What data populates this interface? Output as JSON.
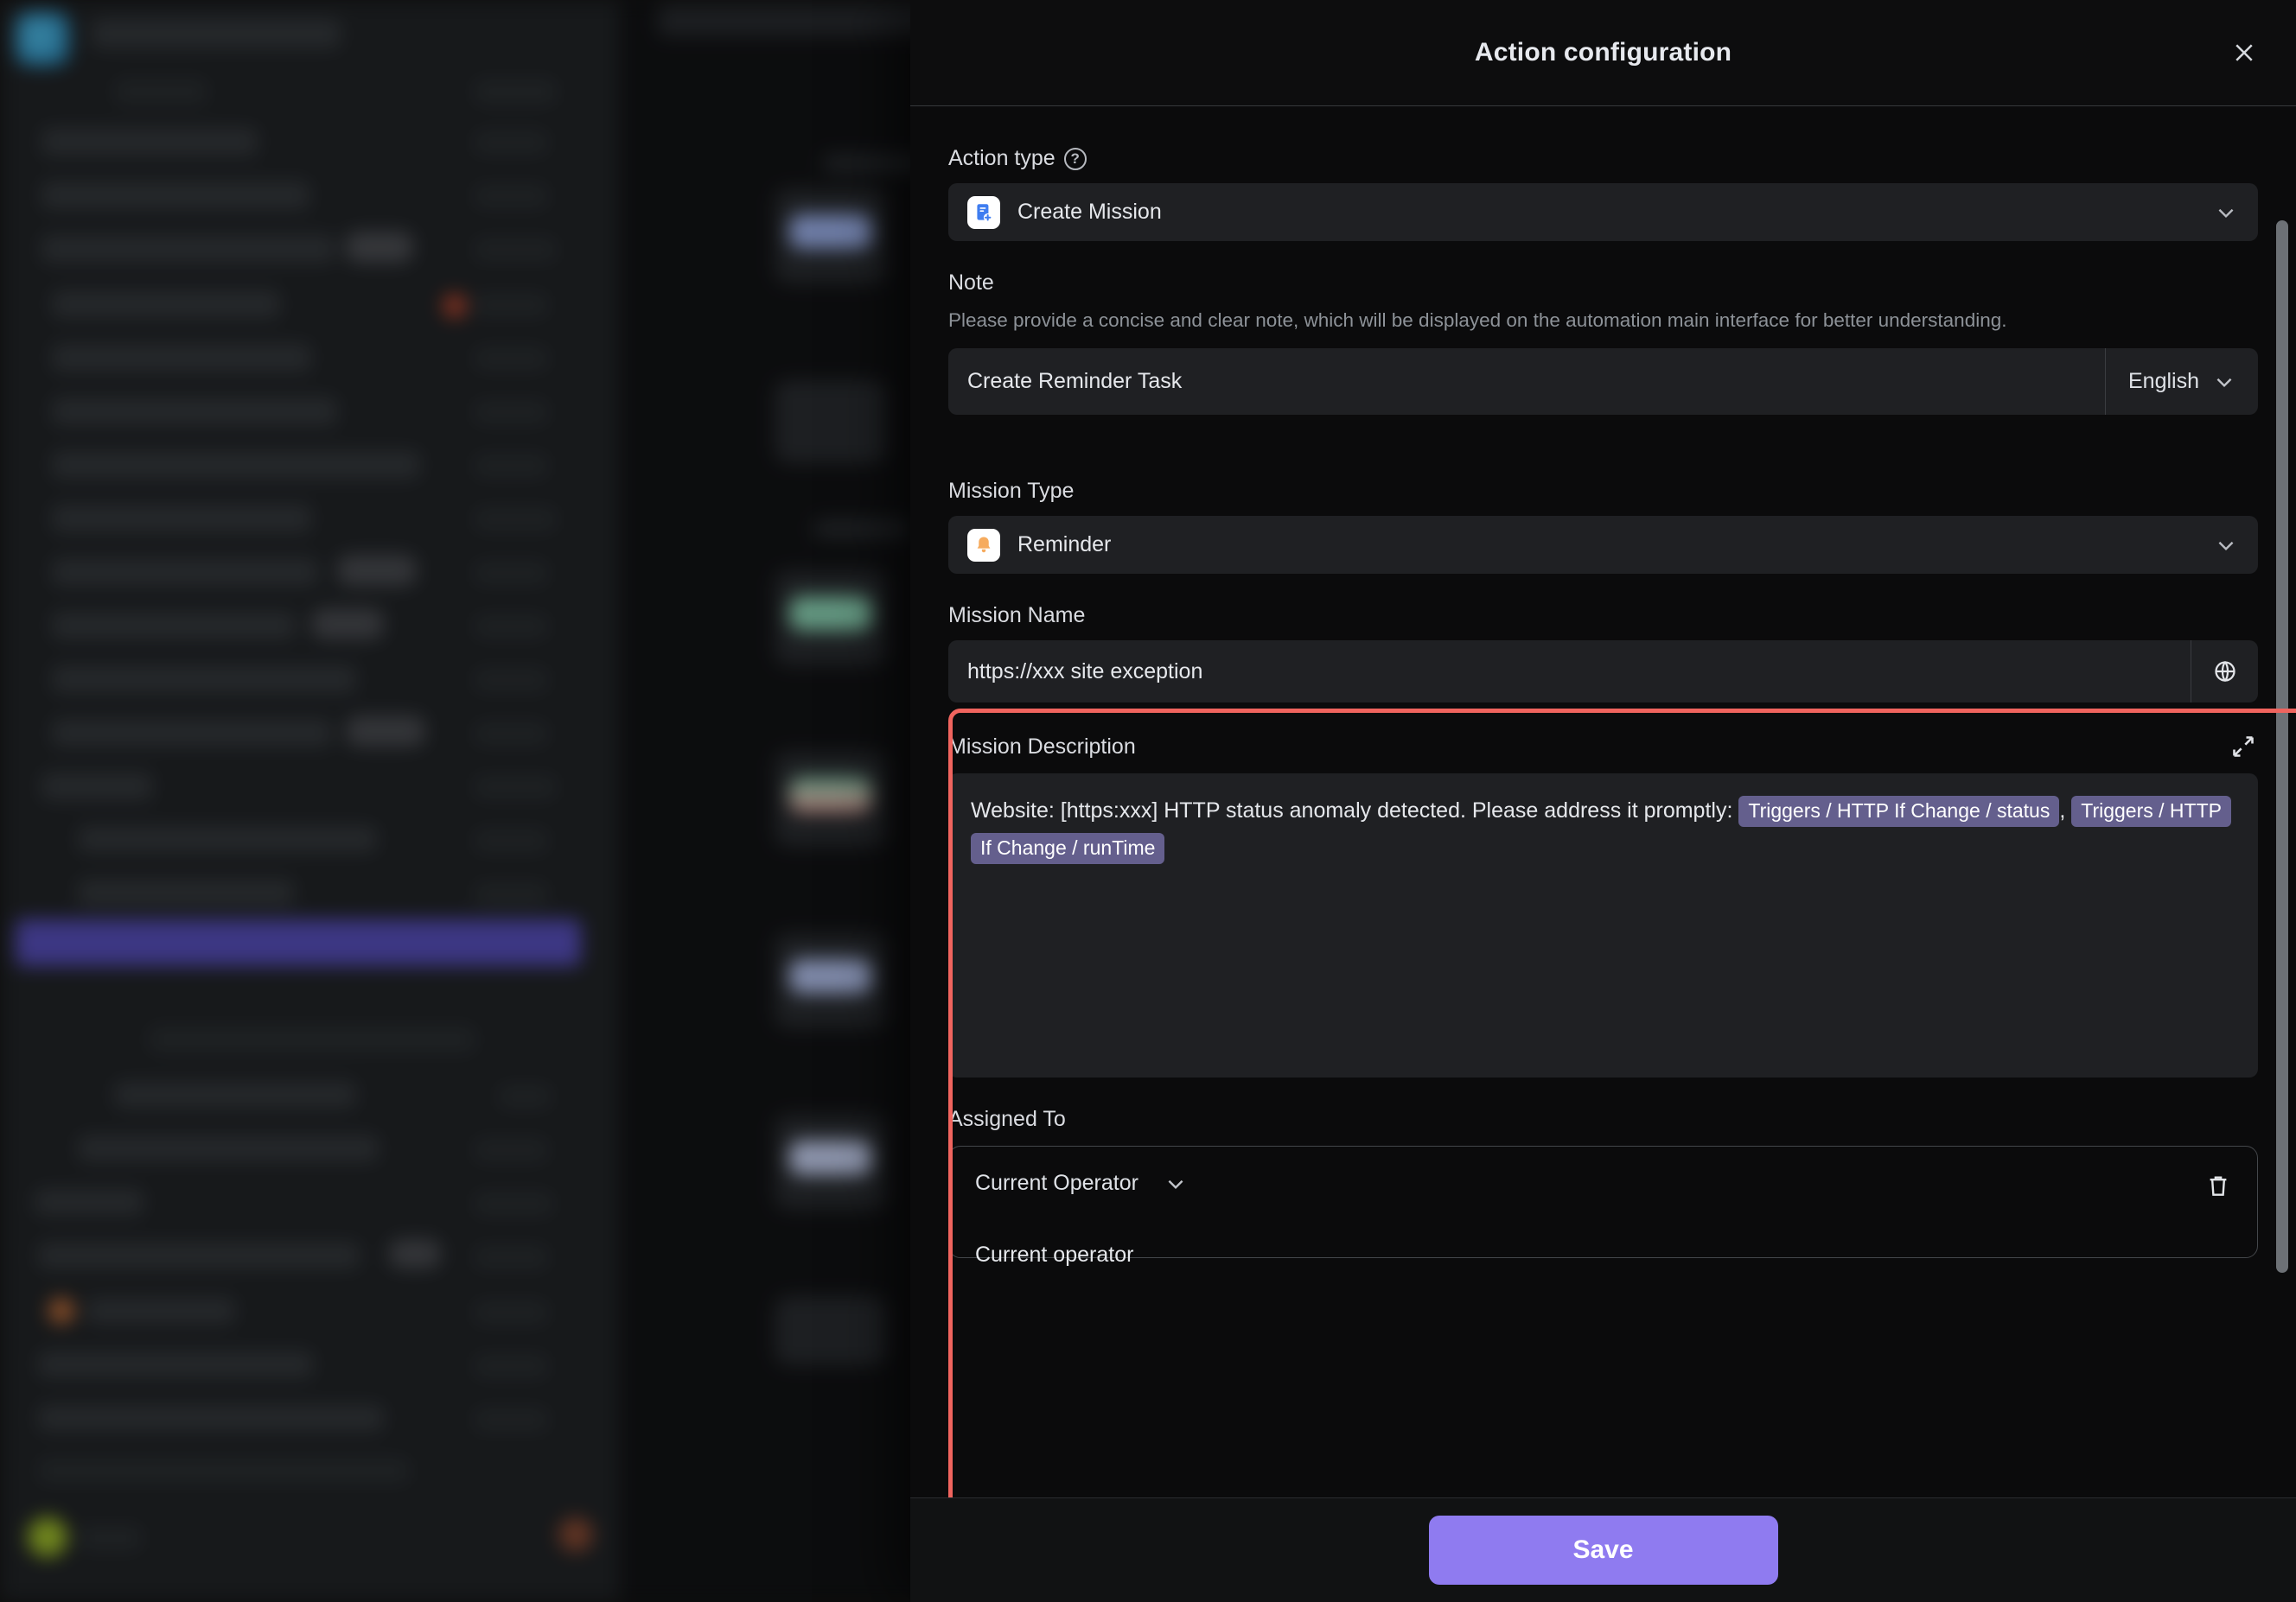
{
  "drawer": {
    "title": "Action configuration",
    "close_icon": "close-icon"
  },
  "action_type": {
    "label": "Action type",
    "help_icon": "question-circle-icon",
    "value": "Create Mission",
    "icon": "create-mission-icon",
    "chevron_icon": "chevron-down-icon"
  },
  "note": {
    "label": "Note",
    "hint": "Please provide a concise and clear note, which will be displayed on the automation main interface for better understanding.",
    "value": "Create Reminder Task",
    "language": "English",
    "language_chevron_icon": "chevron-down-icon"
  },
  "mission_type": {
    "label": "Mission Type",
    "value": "Reminder",
    "icon": "bell-icon",
    "chevron_icon": "chevron-down-icon"
  },
  "mission_name": {
    "label": "Mission Name",
    "value": "https://xxx site exception",
    "globe_icon": "globe-icon"
  },
  "mission_description": {
    "label": "Mission Description",
    "expand_icon": "expand-arrows-icon",
    "text_before": "Website: [https:xxx] HTTP status anomaly detected. Please address it promptly:",
    "tags": [
      "Triggers / HTTP If Change / status",
      "Triggers / HTTP If Change / runTime"
    ],
    "separator": ","
  },
  "assigned_to": {
    "label": "Assigned To",
    "selector_value": "Current Operator",
    "selector_chevron_icon": "chevron-down-icon",
    "sub_value": "Current operator",
    "delete_icon": "trash-icon"
  },
  "footer": {
    "save_label": "Save"
  },
  "colors": {
    "accent": "#8f7bf0",
    "tag": "#645f8d",
    "highlight": "#f0645e",
    "panel_bg": "#0b0b0c",
    "field_bg": "#1f2023"
  }
}
